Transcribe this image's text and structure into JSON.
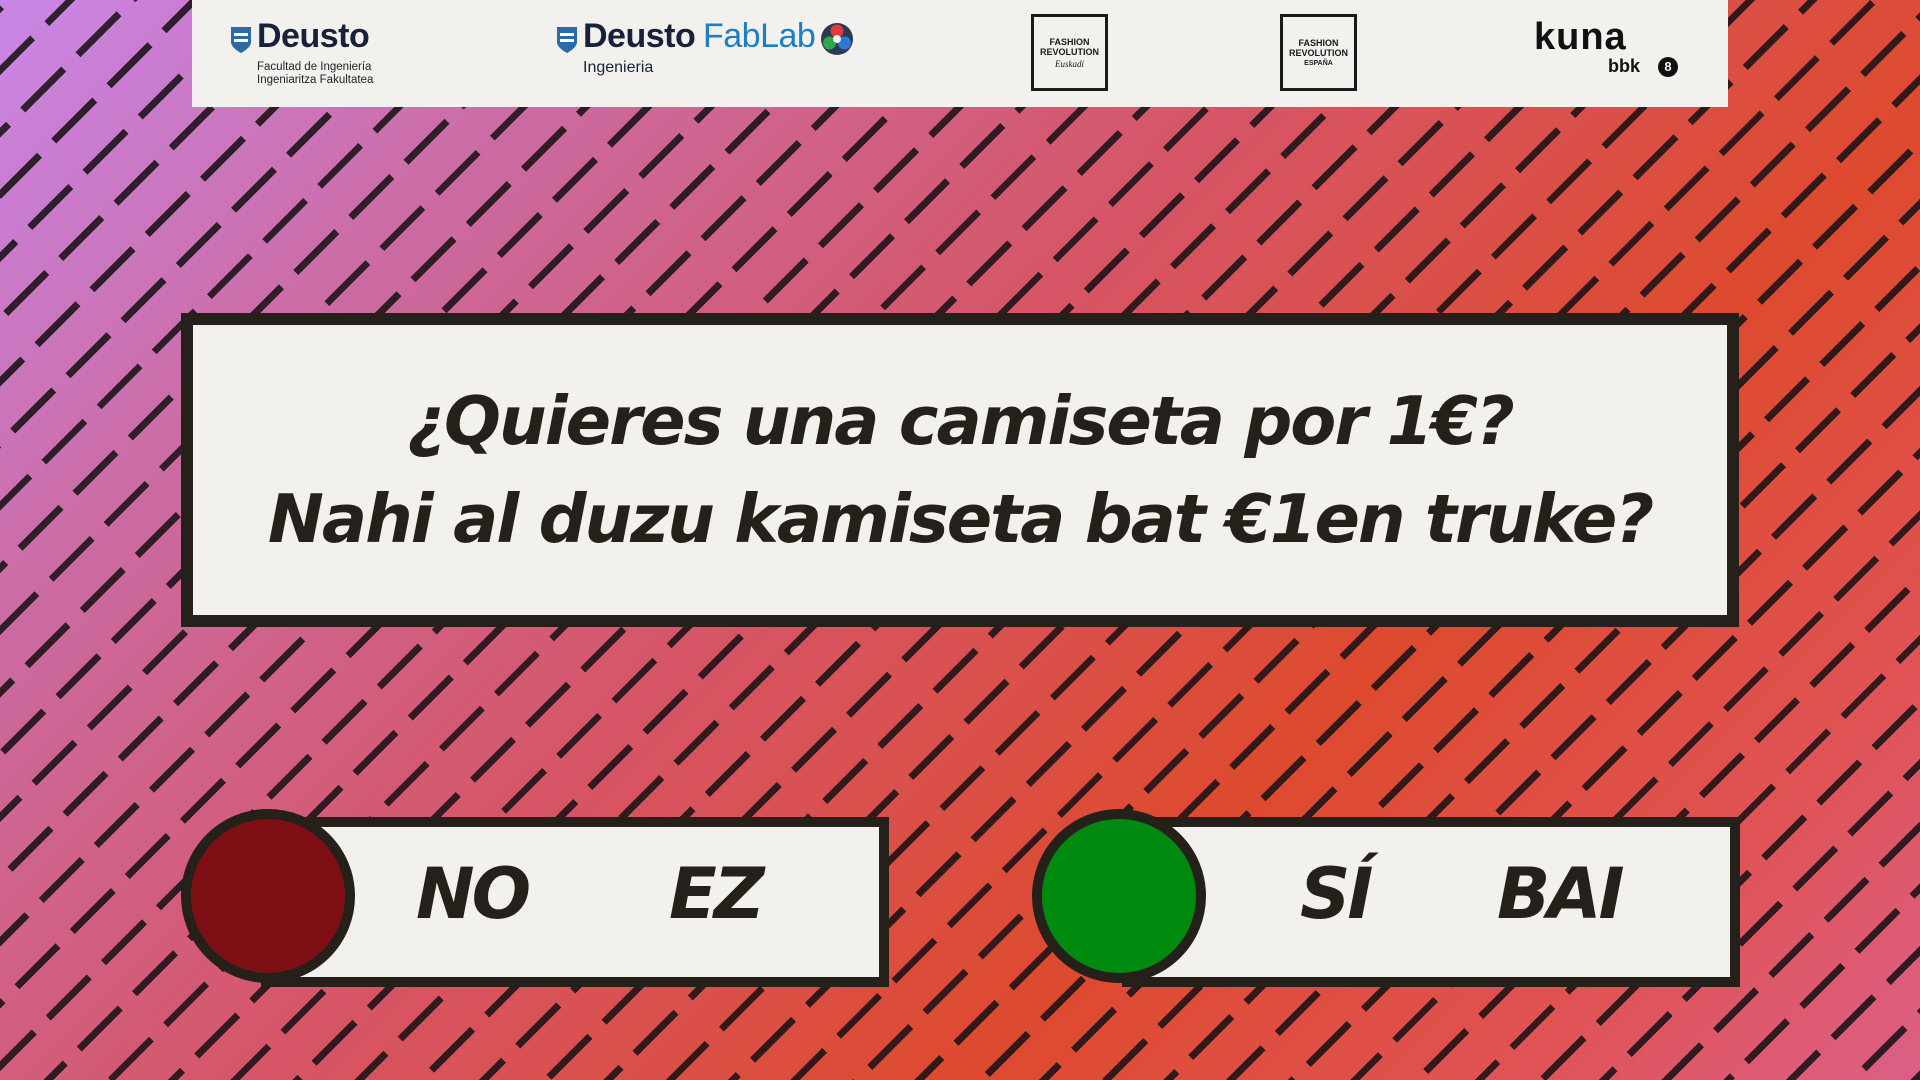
{
  "logos": {
    "deusto": {
      "name": "Deusto",
      "line1": "Facultad de Ingeniería",
      "line2": "Ingeniaritza Fakultatea",
      "icon": "shield-icon"
    },
    "fablab": {
      "name_a": "Deusto",
      "name_b": "FabLab",
      "sub": "Ingenieria",
      "icon": "fablab-icon"
    },
    "fashion_revolution_euskadi": {
      "line1": "FASHION",
      "line2": "REVOLUTION",
      "sub": "Euskadi"
    },
    "fashion_revolution_espana": {
      "line1": "FASHION",
      "line2": "REVOLUTION",
      "sub": "ESPAÑA"
    },
    "kuna": {
      "name": "kuna",
      "sub": "bbk",
      "badge": "8"
    }
  },
  "question": {
    "line_es": "¿Quieres una camiseta por 1€?",
    "line_eu": "Nahi al duzu kamiseta bat €1en truke?"
  },
  "answers": {
    "no": {
      "es": "NO",
      "eu": "EZ",
      "color": "#7e1015"
    },
    "yes": {
      "es": "SÍ",
      "eu": "BAI",
      "color": "#008a10"
    }
  },
  "colors": {
    "ink": "#25211a",
    "panel": "#f3f1ee",
    "fablab_blue": "#1d7ec2"
  }
}
